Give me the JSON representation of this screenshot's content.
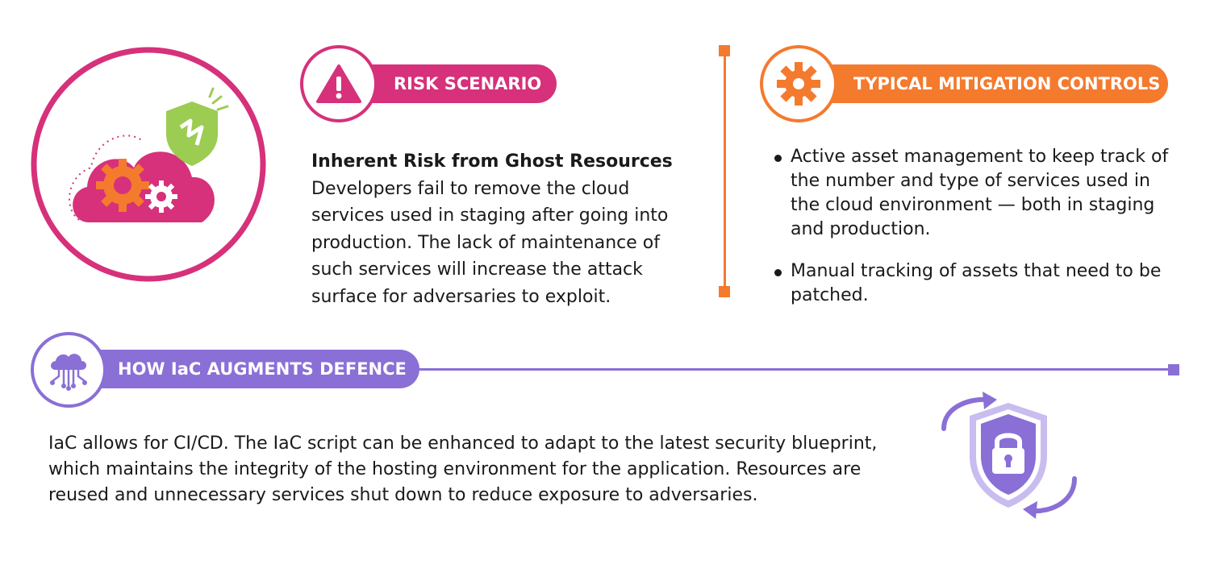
{
  "risk": {
    "badge_label": "RISK SCENARIO",
    "heading": "Inherent Risk from Ghost Resources",
    "body": "Developers fail to remove the cloud services used in staging after going into production. The lack of maintenance of such services will increase the attack surface for adversaries to exploit."
  },
  "mitigation": {
    "badge_label": "TYPICAL MITIGATION CONTROLS",
    "items": [
      "Active asset management to keep track of the number and type of services used in the cloud environment — both in staging and production.",
      "Manual tracking of assets that need to be patched."
    ]
  },
  "iac": {
    "badge_label": "HOW IaC AUGMENTS DEFENCE",
    "body": "IaC allows for CI/CD. The IaC script can be enhanced to adapt to the latest security blueprint, which maintains the integrity of the hosting environment for the application. Resources are reused and unnecessary services shut down to reduce exposure to adversaries."
  },
  "colors": {
    "risk": "#d6317a",
    "mitigation": "#f47a2e",
    "iac": "#8a6fd6",
    "shield_green": "#9ccc52"
  },
  "icons": {
    "hero": "cloud-gears-shield-icon",
    "risk": "warning-triangle-icon",
    "mitigation": "gear-icon",
    "iac": "cloud-network-icon",
    "security": "shield-lock-refresh-icon"
  }
}
